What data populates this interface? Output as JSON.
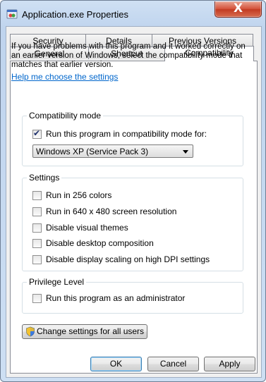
{
  "window": {
    "title": "Application.exe Properties",
    "close_symbol": "X"
  },
  "tabs": {
    "row1": [
      "Security",
      "Details",
      "Previous Versions"
    ],
    "row2": [
      "General",
      "Shortcut",
      "Compatibility"
    ],
    "active": "Compatibility"
  },
  "intro": "If you have problems with this program and it worked correctly on an earlier version of Windows, select the compatibility mode that matches that earlier version.",
  "help_link": "Help me choose the settings",
  "compat_mode": {
    "legend": "Compatibility mode",
    "checkbox_label": "Run this program in compatibility mode for:",
    "checked": true,
    "selected_os": "Windows XP (Service Pack 3)"
  },
  "settings": {
    "legend": "Settings",
    "items": [
      {
        "label": "Run in 256 colors",
        "checked": false
      },
      {
        "label": "Run in 640 x 480 screen resolution",
        "checked": false
      },
      {
        "label": "Disable visual themes",
        "checked": false
      },
      {
        "label": "Disable desktop composition",
        "checked": false
      },
      {
        "label": "Disable display scaling on high DPI settings",
        "checked": false
      }
    ]
  },
  "privilege": {
    "legend": "Privilege Level",
    "checkbox_label": "Run this program as an administrator",
    "checked": false
  },
  "change_all_users": "Change settings for all users",
  "buttons": {
    "ok": "OK",
    "cancel": "Cancel",
    "apply": "Apply"
  }
}
